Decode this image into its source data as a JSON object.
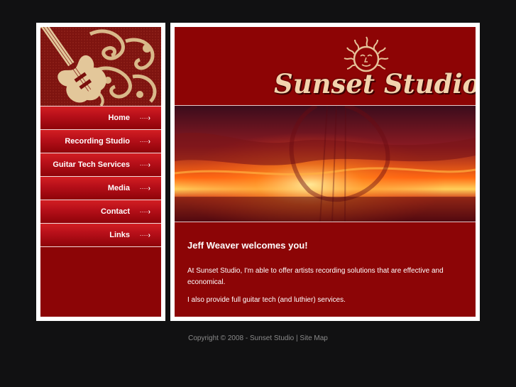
{
  "nav": {
    "items": [
      {
        "label": "Home",
        "arrow": "····"
      },
      {
        "label": "Recording Studio",
        "arrow": "····"
      },
      {
        "label": "Guitar Tech Services",
        "arrow": "····"
      },
      {
        "label": "Media",
        "arrow": "····"
      },
      {
        "label": "Contact",
        "arrow": "····"
      },
      {
        "label": "Links",
        "arrow": "····"
      }
    ]
  },
  "header": {
    "title": "Sunset Studio",
    "logo_icon": "sun-face-icon"
  },
  "content": {
    "heading": "Jeff Weaver welcomes you!",
    "paragraph_1": "At Sunset Studio, I'm able to offer artists recording solutions that are effective and economical.",
    "paragraph_2": "I also provide full guitar tech (and luthier) services."
  },
  "footer": {
    "copyright": "Copyright © 2008 - Sunset Studio",
    "separator": "|",
    "site_map": "Site Map"
  },
  "colors": {
    "page_bg": "#111112",
    "panel_red": "#8c0506",
    "nav_top": "#d21e22",
    "brand_text": "#f3d3ad"
  }
}
